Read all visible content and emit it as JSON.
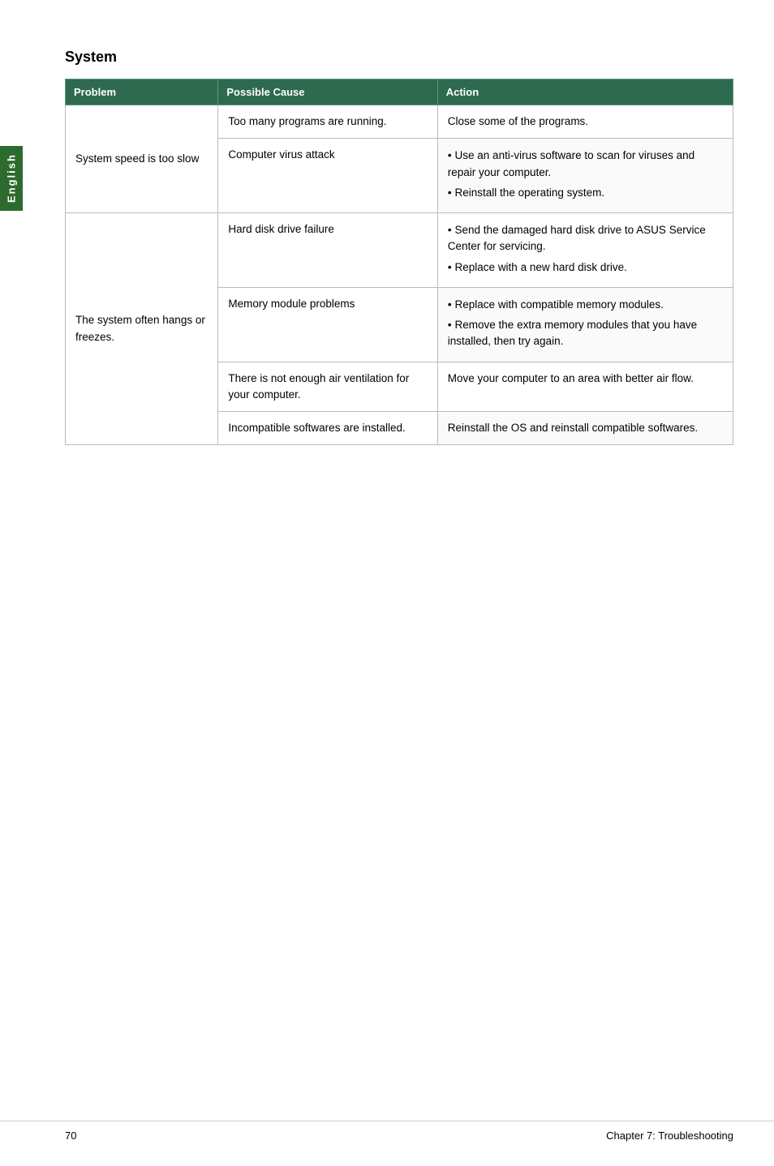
{
  "page": {
    "side_tab_label": "English",
    "section_title": "System",
    "footer_page": "70",
    "footer_chapter": "Chapter 7: Troubleshooting"
  },
  "table": {
    "headers": {
      "problem": "Problem",
      "possible_cause": "Possible Cause",
      "action": "Action"
    },
    "rows": [
      {
        "problem": "System speed is too slow",
        "possible_cause": "Too many programs are running.",
        "action_type": "text",
        "action": "Close some of the programs."
      },
      {
        "problem": "",
        "possible_cause": "Computer virus attack",
        "action_type": "bullets",
        "action_bullets": [
          "Use an anti-virus software to scan for viruses and repair your computer.",
          "Reinstall the operating system."
        ]
      },
      {
        "problem": "The system often hangs or freezes.",
        "possible_cause": "Hard disk drive failure",
        "action_type": "bullets",
        "action_bullets": [
          "Send the damaged hard disk drive to ASUS Service Center for servicing.",
          "Replace with a new hard disk drive."
        ]
      },
      {
        "problem": "",
        "possible_cause": "Memory module problems",
        "action_type": "bullets",
        "action_bullets": [
          "Replace with compatible memory modules.",
          "Remove the extra memory modules that you have installed, then try again."
        ]
      },
      {
        "problem": "",
        "possible_cause": "There is not enough air ventilation for your computer.",
        "action_type": "text",
        "action": "Move your computer to an area with better air flow."
      },
      {
        "problem": "",
        "possible_cause": "Incompatible softwares are installed.",
        "action_type": "text",
        "action": "Reinstall the OS and reinstall compatible softwares."
      }
    ]
  }
}
